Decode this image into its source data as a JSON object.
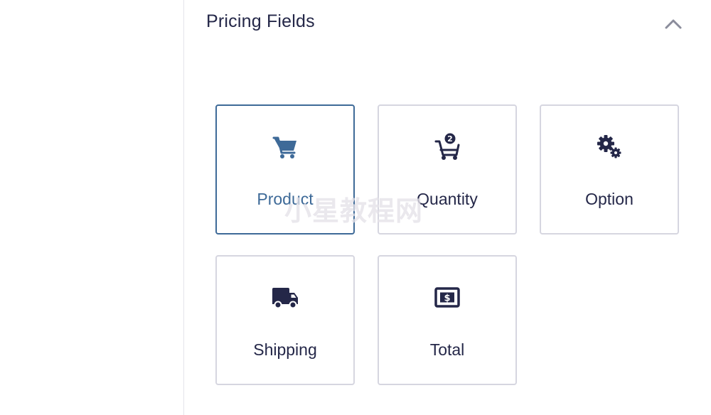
{
  "section": {
    "title": "Pricing Fields",
    "collapse_icon": "chevron-up-icon"
  },
  "fields": [
    {
      "label": "Product",
      "icon": "shopping-cart-icon",
      "active": true
    },
    {
      "label": "Quantity",
      "icon": "cart-quantity-icon",
      "badge": "2"
    },
    {
      "label": "Option",
      "icon": "gears-icon"
    },
    {
      "label": "Shipping",
      "icon": "truck-icon"
    },
    {
      "label": "Total",
      "icon": "money-bill-icon"
    }
  ],
  "watermark": "小星教程网",
  "colors": {
    "text": "#242748",
    "active": "#3e6a98",
    "border": "#d6d6e0"
  }
}
